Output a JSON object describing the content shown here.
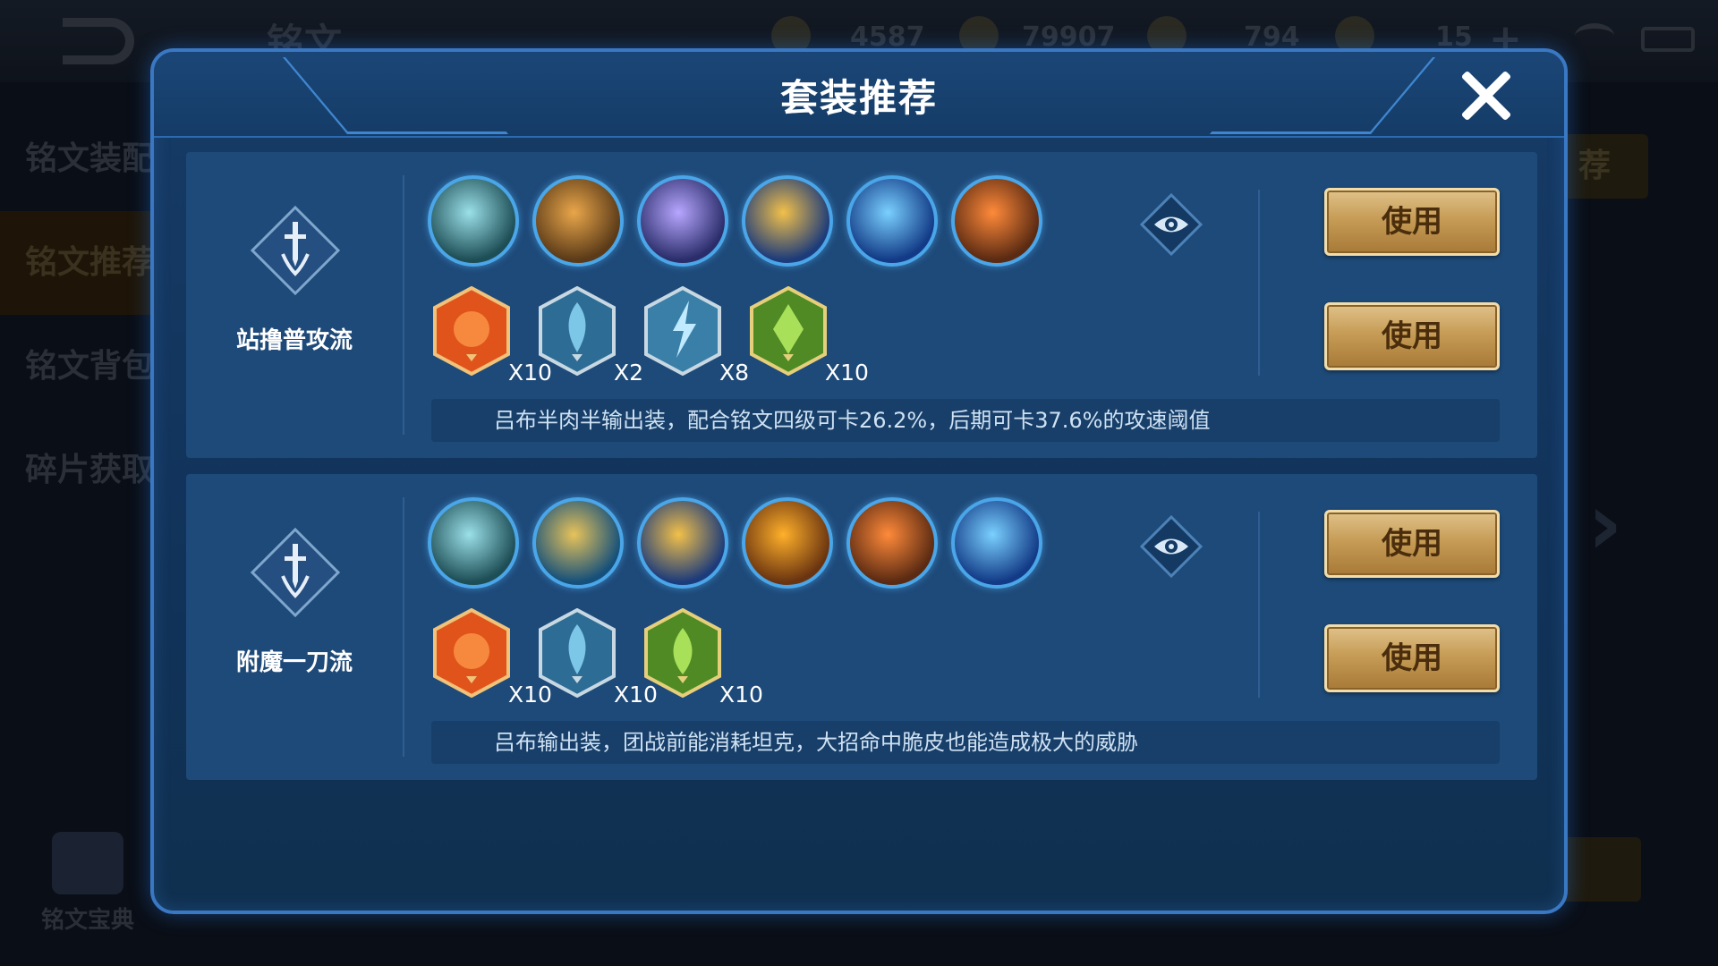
{
  "background": {
    "title": "铭文",
    "resources": [
      {
        "icon": "gem-icon",
        "value": "4587"
      },
      {
        "icon": "coin-icon",
        "value": "79907"
      },
      {
        "icon": "fragment-icon",
        "value": "794"
      },
      {
        "icon": "voucher-icon",
        "value": "15"
      }
    ],
    "sidebar": [
      "铭文装配",
      "铭文推荐",
      "铭文背包",
      "碎片获取"
    ],
    "book_label": "铭文宝典",
    "right_button": "荐"
  },
  "modal": {
    "title": "套装推荐",
    "sets": [
      {
        "name": "站撸普攻流",
        "equipment": [
          {
            "icon": "boots-icon",
            "colors": [
              "#1d4d55",
              "#9be0e8"
            ]
          },
          {
            "icon": "armor-icon",
            "colors": [
              "#5a3a18",
              "#e9a64a"
            ]
          },
          {
            "icon": "cloak-icon",
            "colors": [
              "#2a2d6a",
              "#b7a6ff"
            ]
          },
          {
            "icon": "trident-icon",
            "colors": [
              "#1c3b7a",
              "#f2c04a"
            ]
          },
          {
            "icon": "blade-icon",
            "colors": [
              "#123a86",
              "#7ad0ff"
            ]
          },
          {
            "icon": "fang-blade-icon",
            "colors": [
              "#5a2a12",
              "#ff8a3a"
            ]
          }
        ],
        "runes": [
          {
            "icon": "red-rune-icon",
            "color": "#e0541c",
            "count": "X10"
          },
          {
            "icon": "blue-rune-icon",
            "color": "#7cc6e8",
            "count": "X2"
          },
          {
            "icon": "blue-lightning-rune-icon",
            "color": "#8fd8f2",
            "count": "X8"
          },
          {
            "icon": "green-rune-icon",
            "color": "#7fbf3a",
            "count": "X10"
          }
        ],
        "description": "吕布半肉半输出装，配合铭文四级可卡26.2%，后期可卡37.6%的攻速阈值",
        "use_labels": [
          "使用",
          "使用"
        ]
      },
      {
        "name": "附魔一刀流",
        "equipment": [
          {
            "icon": "boots-icon",
            "colors": [
              "#1d4d55",
              "#9be0e8"
            ]
          },
          {
            "icon": "shield-icon",
            "colors": [
              "#15507a",
              "#e7c35a"
            ]
          },
          {
            "icon": "trident-icon",
            "colors": [
              "#1c3b7a",
              "#f2c04a"
            ]
          },
          {
            "icon": "fire-bow-icon",
            "colors": [
              "#6a3410",
              "#ffb02a"
            ]
          },
          {
            "icon": "fang-blade-icon",
            "colors": [
              "#5a2a12",
              "#ff8a3a"
            ]
          },
          {
            "icon": "blade-icon",
            "colors": [
              "#123a86",
              "#7ad0ff"
            ]
          }
        ],
        "runes": [
          {
            "icon": "red-rune-icon",
            "color": "#e0541c",
            "count": "X10"
          },
          {
            "icon": "blue-rune-icon",
            "color": "#7cc6e8",
            "count": "X10"
          },
          {
            "icon": "green-rune-icon",
            "color": "#7fbf3a",
            "count": "X10"
          }
        ],
        "description": "吕布输出装，团战前能消耗坦克，大招命中脆皮也能造成极大的威胁",
        "use_labels": [
          "使用",
          "使用"
        ]
      }
    ]
  }
}
